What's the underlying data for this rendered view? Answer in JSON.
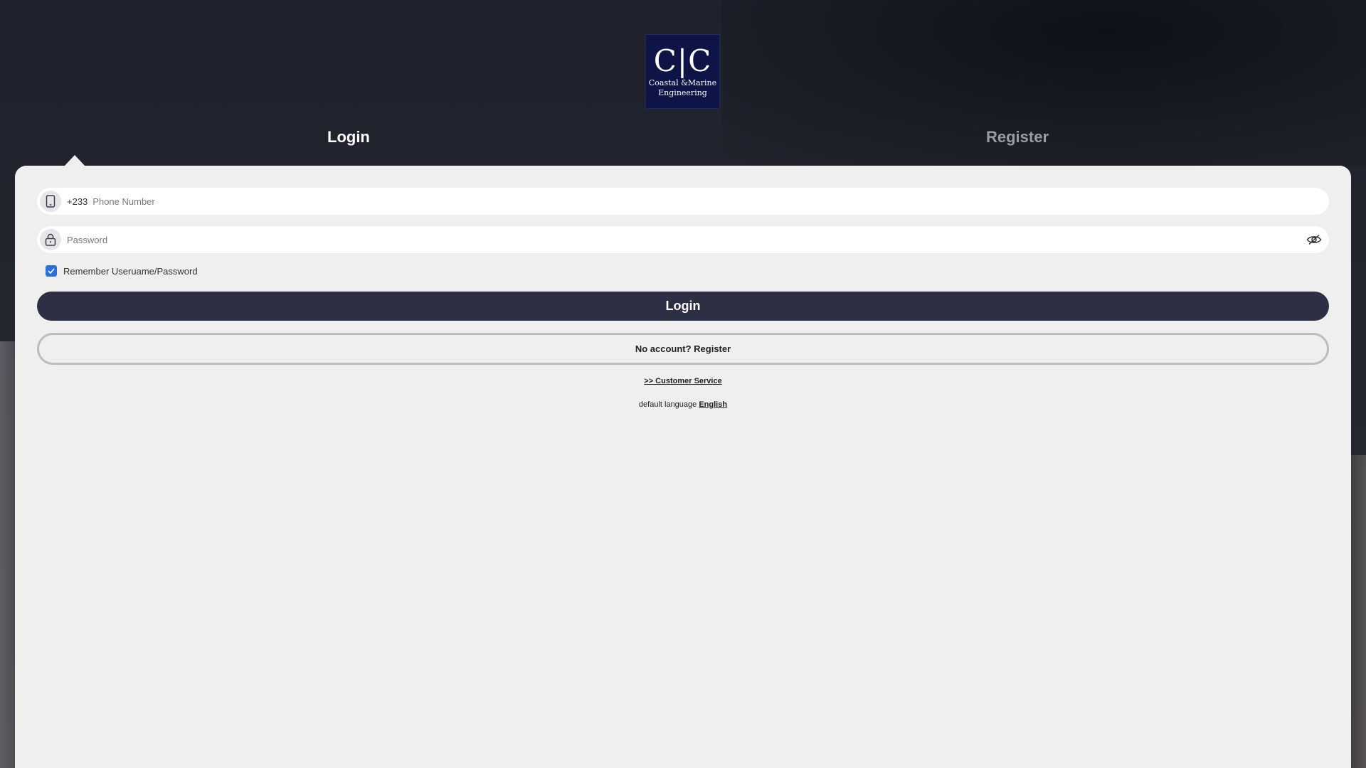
{
  "logo": {
    "mark": "C|C",
    "subtitle_line1": "Coastal &Marine",
    "subtitle_line2": "Engineering"
  },
  "tabs": [
    {
      "label": "Login",
      "active": true
    },
    {
      "label": "Register",
      "active": false
    }
  ],
  "form": {
    "phone": {
      "prefix": "+233",
      "placeholder": "Phone Number",
      "value": "",
      "icon": "phone-icon"
    },
    "password": {
      "placeholder": "Password",
      "value": "",
      "icon": "lock-icon",
      "toggle_icon": "eye-hidden-icon"
    },
    "remember": {
      "label": "Remember Useruame/Password",
      "checked": true
    },
    "login_button": "Login",
    "register_button": "No account? Register"
  },
  "footer": {
    "customer_service": ">> Customer Service",
    "language_prefix": "default language",
    "language": "English"
  },
  "colors": {
    "primary_button": "#2d2f45",
    "checkbox": "#2a6fdb",
    "logo_bg": "#0e1446",
    "panel_bg": "#efefef"
  }
}
